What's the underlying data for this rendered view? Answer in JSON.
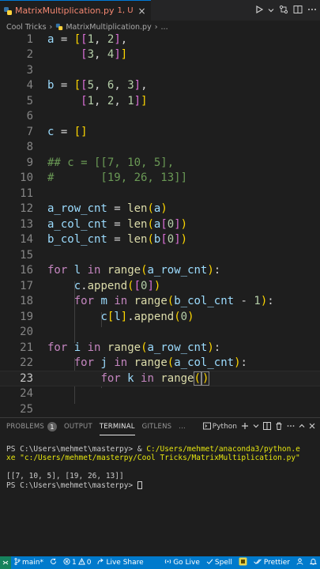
{
  "tabbar": {
    "filename": "MatrixMultiplication.py",
    "state": "1, U",
    "close": "×"
  },
  "breadcrumb": {
    "folder": "Cool Tricks",
    "file": "MatrixMultiplication.py",
    "symbol": "..."
  },
  "editor": {
    "line_numbers": [
      "1",
      "2",
      "3",
      "4",
      "5",
      "6",
      "7",
      "8",
      "9",
      "10",
      "11",
      "12",
      "13",
      "14",
      "15",
      "16",
      "17",
      "18",
      "19",
      "20",
      "21",
      "22",
      "23",
      "24",
      "25"
    ],
    "current_line": 23
  },
  "panel": {
    "tabs": [
      "PROBLEMS",
      "OUTPUT",
      "TERMINAL",
      "GITLENS"
    ],
    "problems_count": "1",
    "more": "...",
    "shell": "Python",
    "terminal": {
      "prompt1": "PS C:\\Users\\mehmet\\masterpy> ",
      "amp": "& ",
      "python_path": "C:/Users/mehmet/anaconda3/python.e",
      "wrap": "xe",
      "script_path": " \"c:/Users/mehmet/masterpy/Cool Tricks/MatrixMultiplication.py\"",
      "output": "[[7, 10, 5], [19, 26, 13]]",
      "prompt2": "PS C:\\Users\\mehmet\\masterpy> "
    }
  },
  "statusbar": {
    "branch": "main*",
    "errors": "1",
    "warnings": "0",
    "liveshare": "Live Share",
    "golive": "Go Live",
    "spell": "Spell",
    "prettier": "Prettier"
  },
  "colors": {
    "statusbar": "#007acc",
    "error_tab": "#f48771",
    "keyword": "#c586c0",
    "variable": "#9cdcfe",
    "function": "#dcdcaa",
    "number": "#b5cea8",
    "comment": "#6a9955"
  }
}
